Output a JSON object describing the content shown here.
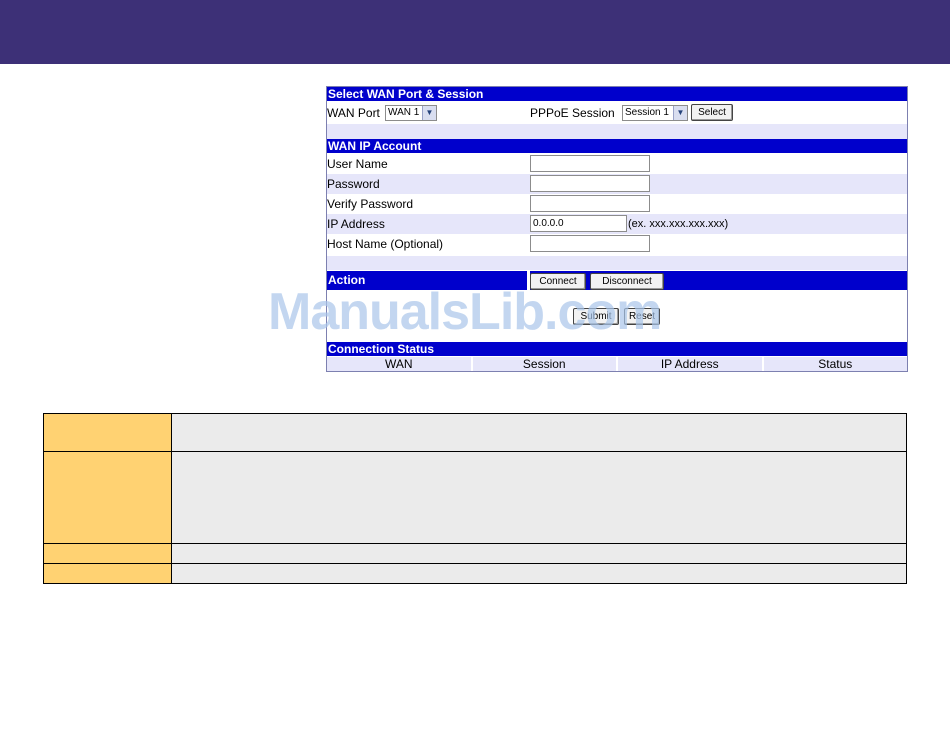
{
  "select_wan": {
    "header": "Select WAN Port & Session",
    "wan_port_label": "WAN Port",
    "wan_port_value": "WAN 1",
    "pppoe_session_label": "PPPoE Session",
    "pppoe_session_value": "Session 1",
    "select_button": "Select"
  },
  "account": {
    "header": "WAN IP Account",
    "user_name_label": "User Name",
    "user_name_value": "",
    "password_label": "Password",
    "password_value": "",
    "verify_password_label": "Verify Password",
    "verify_password_value": "",
    "ip_address_label": "IP Address",
    "ip_address_value": "0.0.0.0",
    "ip_address_hint": "(ex. xxx.xxx.xxx.xxx)",
    "host_name_label": "Host Name (Optional)",
    "host_name_value": ""
  },
  "action": {
    "header": "Action",
    "connect_button": "Connect",
    "disconnect_button": "Disconnect",
    "submit_button": "Submit",
    "reset_button": "Reset"
  },
  "connection_status": {
    "header": "Connection Status",
    "columns": [
      "WAN",
      "Session",
      "IP Address",
      "Status"
    ]
  },
  "watermark": "ManualsLib.com",
  "colors": {
    "banner": "#3d3077",
    "section_header": "#0000cc",
    "row_alt": "#e6e6fa",
    "table_key": "#ffd272",
    "table_value": "#ebebeb"
  }
}
